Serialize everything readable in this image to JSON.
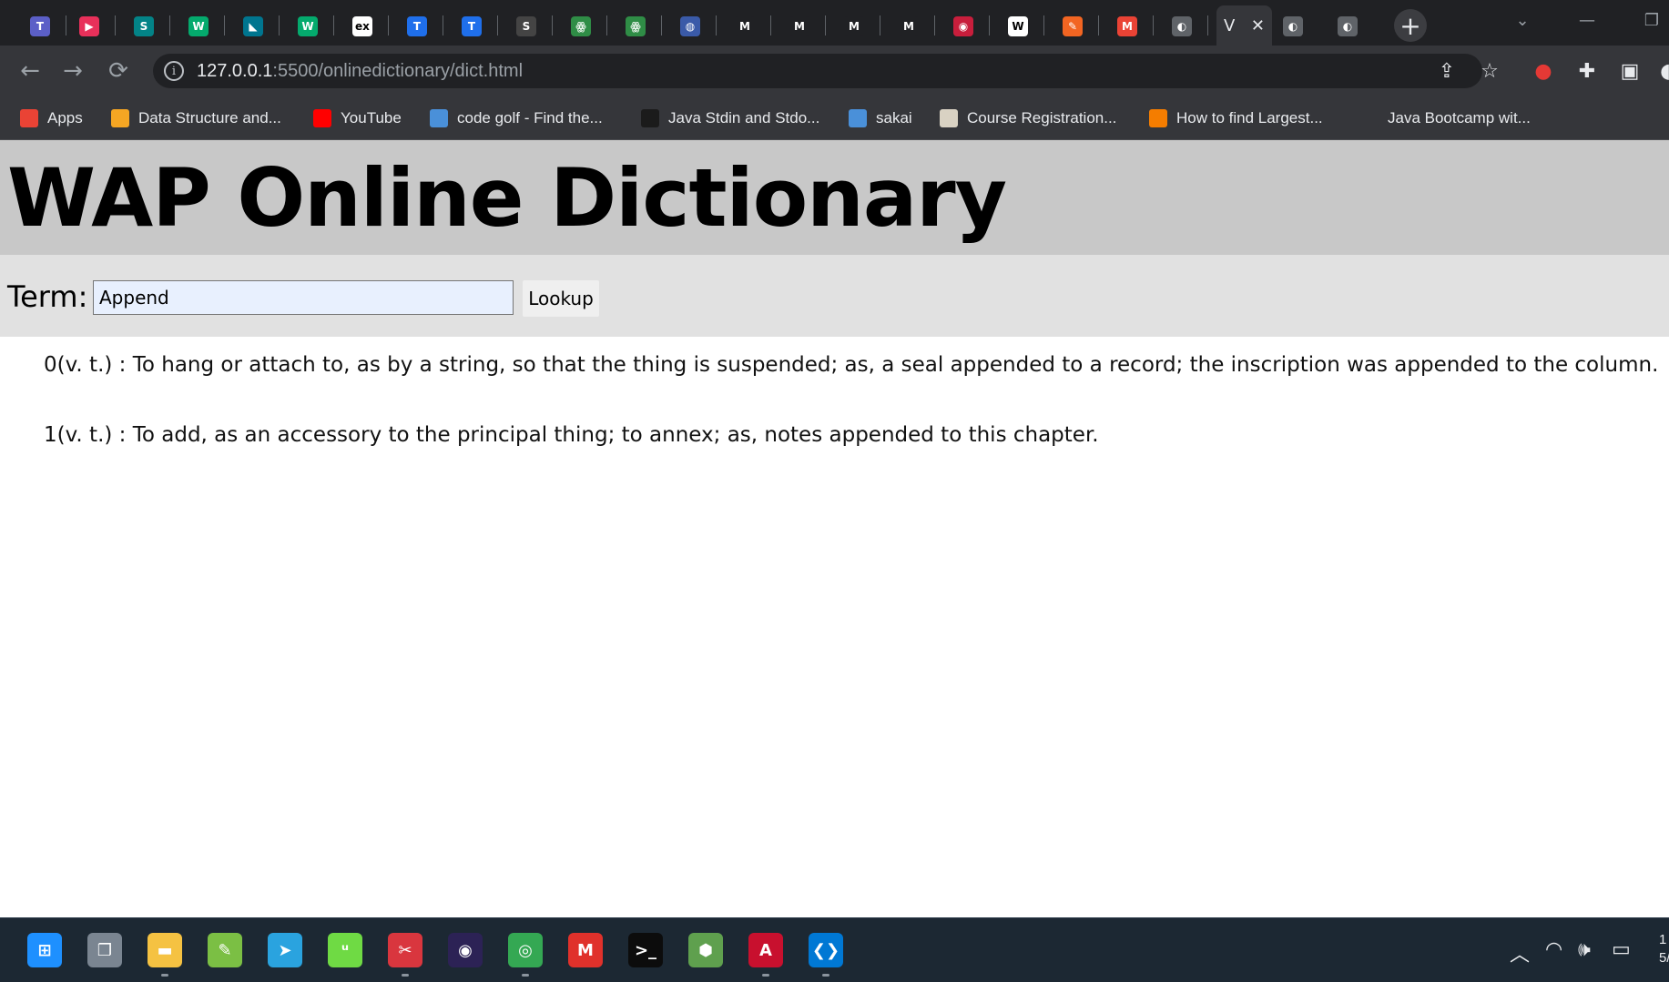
{
  "browser": {
    "tabs": [
      {
        "icon": "teams-icon",
        "glyph": "T",
        "color": "#5b5fc7"
      },
      {
        "icon": "play-icon",
        "glyph": "▶",
        "color": "#e8305a"
      },
      {
        "icon": "sharepoint-icon",
        "glyph": "S",
        "color": "#038387"
      },
      {
        "icon": "w3schools-icon",
        "glyph": "W",
        "color": "#04aa6d"
      },
      {
        "icon": "mysql-icon",
        "glyph": "◣",
        "color": "#00758f"
      },
      {
        "icon": "w3schools-icon",
        "glyph": "W",
        "color": "#04aa6d"
      },
      {
        "icon": "ex-icon",
        "glyph": "ex",
        "color": "#ffffff"
      },
      {
        "icon": "t-icon",
        "glyph": "T",
        "color": "#1f6feb"
      },
      {
        "icon": "t-icon",
        "glyph": "T",
        "color": "#1f6feb"
      },
      {
        "icon": "s-icon",
        "glyph": "S",
        "color": "#444444"
      },
      {
        "icon": "geeksforgeeks-icon",
        "glyph": "ꙮ",
        "color": "#2f8d46"
      },
      {
        "icon": "geeksforgeeks-icon",
        "glyph": "ꙮ",
        "color": "#2f8d46"
      },
      {
        "icon": "globe-seal-icon",
        "glyph": "◍",
        "color": "#3a5aa8"
      },
      {
        "icon": "m-icon",
        "glyph": "M",
        "color": "#202124"
      },
      {
        "icon": "m-icon",
        "glyph": "M",
        "color": "#202124"
      },
      {
        "icon": "m-icon",
        "glyph": "M",
        "color": "#202124"
      },
      {
        "icon": "m-icon",
        "glyph": "M",
        "color": "#202124"
      },
      {
        "icon": "coding-icon",
        "glyph": "◉",
        "color": "#c81e3c"
      },
      {
        "icon": "wikipedia-icon",
        "glyph": "W",
        "color": "#ffffff"
      },
      {
        "icon": "pen-icon",
        "glyph": "✎",
        "color": "#f26522"
      },
      {
        "icon": "gmail-icon",
        "glyph": "M",
        "color": "#ea4335"
      },
      {
        "icon": "globe-icon",
        "glyph": "◐",
        "color": "#5f6368"
      }
    ],
    "active_tab_label": "V",
    "tabs_after": [
      {
        "icon": "globe-icon",
        "glyph": "◐",
        "color": "#5f6368"
      },
      {
        "icon": "globe-icon",
        "glyph": "◐",
        "color": "#5f6368"
      }
    ],
    "new_tab": "+",
    "url_host": "127.0.0.1",
    "url_rest": ":5500/onlinedictionary/dict.html",
    "bookmarks": [
      {
        "label": "Apps",
        "icon": "apps-grid-icon",
        "color": "#ea4335"
      },
      {
        "label": "Data Structure and...",
        "icon": "jb-icon",
        "color": "#f5a623"
      },
      {
        "label": "YouTube",
        "icon": "youtube-icon",
        "color": "#ff0000"
      },
      {
        "label": "code golf - Find the...",
        "icon": "pcg-icon",
        "color": "#4a90d9"
      },
      {
        "label": "Java Stdin and Stdo...",
        "icon": "hackerrank-icon",
        "color": "#1b1b1b"
      },
      {
        "label": "sakai",
        "icon": "sakai-icon",
        "color": "#4a90d9"
      },
      {
        "label": "Course Registration...",
        "icon": "course-icon",
        "color": "#d9d2c3"
      },
      {
        "label": "How to find Largest...",
        "icon": "blogger-icon",
        "color": "#f57d00"
      },
      {
        "label": "Java Bootcamp wit...",
        "icon": "bootcamp-icon",
        "color": "#35363a"
      }
    ]
  },
  "page": {
    "title": "WAP Online Dictionary",
    "term_label": "Term:",
    "term_value": "Append",
    "lookup_label": "Lookup",
    "definitions": [
      "0(v. t.) : To hang or attach to, as by a string, so that the thing is suspended; as, a seal appended to a record; the inscription was appended to the column.",
      "1(v. t.) : To add, as an accessory to the principal thing; to annex; as, notes appended to this chapter."
    ]
  },
  "taskbar": {
    "apps": [
      {
        "icon": "windows-start-icon",
        "glyph": "⊞",
        "color": "#1e90ff"
      },
      {
        "icon": "task-view-icon",
        "glyph": "❐",
        "color": "#7a8591"
      },
      {
        "icon": "file-explorer-icon",
        "glyph": "▬",
        "color": "#f5c242"
      },
      {
        "icon": "notepad-icon",
        "glyph": "✎",
        "color": "#7bbf44"
      },
      {
        "icon": "telegram-icon",
        "glyph": "➤",
        "color": "#2aa3df"
      },
      {
        "icon": "upwork-icon",
        "glyph": "ᵘ",
        "color": "#6fda44"
      },
      {
        "icon": "snipping-tool-icon",
        "glyph": "✂",
        "color": "#d9363e"
      },
      {
        "icon": "eclipse-icon",
        "glyph": "◉",
        "color": "#2c2255"
      },
      {
        "icon": "chrome-icon",
        "glyph": "◎",
        "color": "#34a853"
      },
      {
        "icon": "mail-m-icon",
        "glyph": "M",
        "color": "#e0312b"
      },
      {
        "icon": "terminal-icon",
        "glyph": ">_",
        "color": "#0c0c0c"
      },
      {
        "icon": "nodejs-icon",
        "glyph": "⬢",
        "color": "#5fa04e"
      },
      {
        "icon": "acrobat-icon",
        "glyph": "A",
        "color": "#c8102e"
      },
      {
        "icon": "vscode-icon",
        "glyph": "❮❯",
        "color": "#0078d4"
      }
    ],
    "clock_time": "1",
    "clock_date": "5/"
  }
}
